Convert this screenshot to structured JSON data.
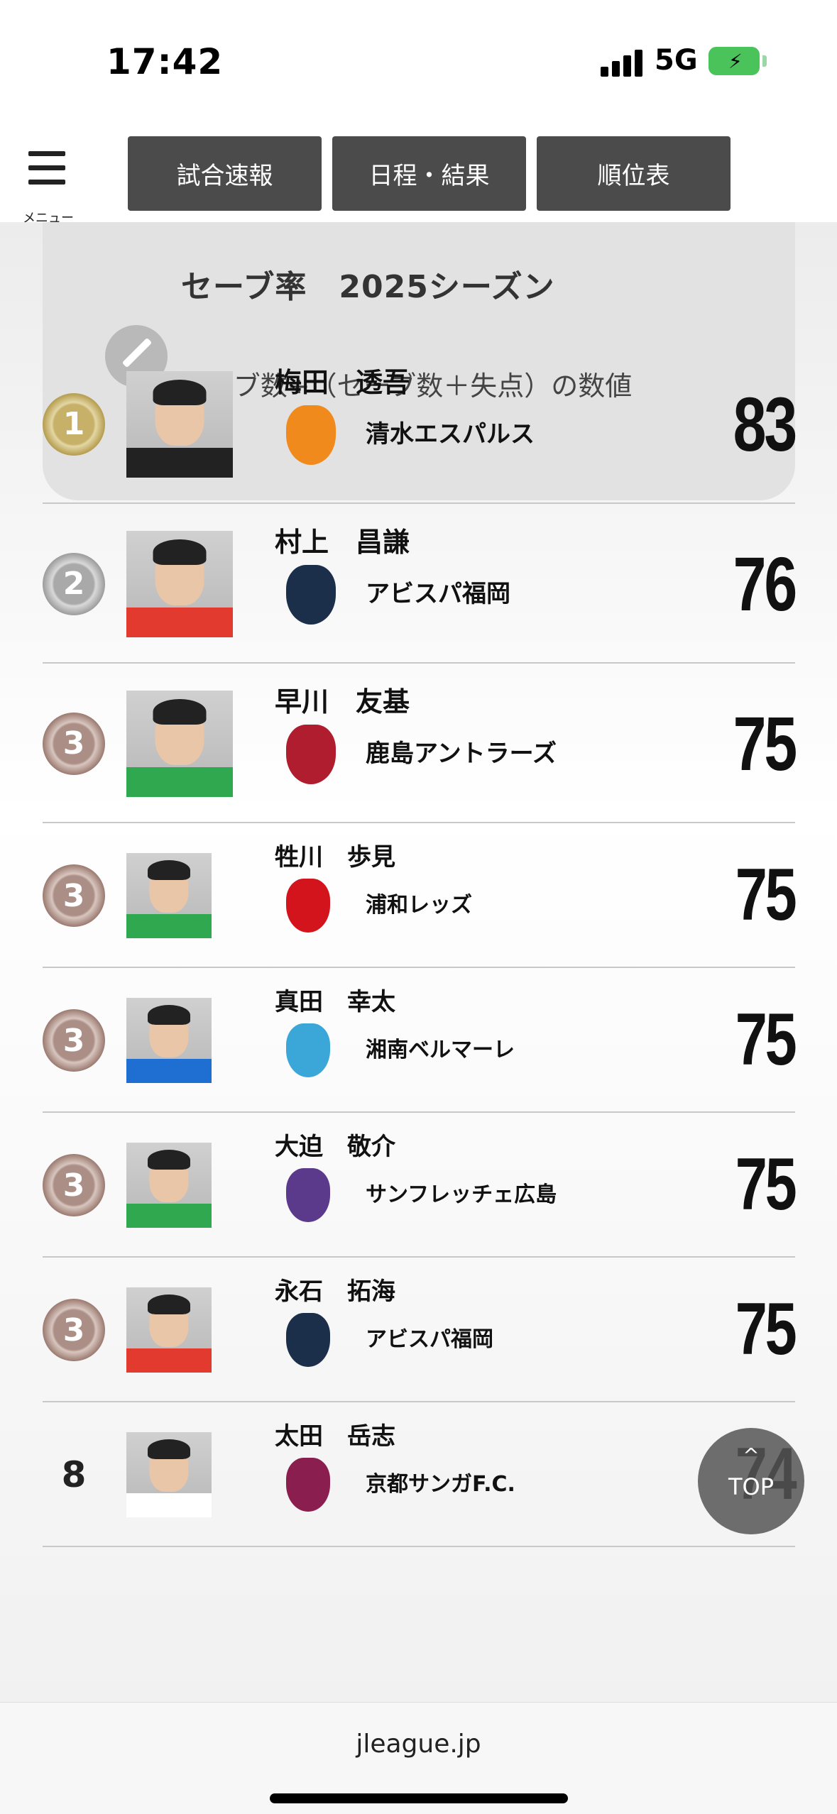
{
  "status_bar": {
    "time": "17:42",
    "network": "5G",
    "battery_color": "#4ac35a"
  },
  "header": {
    "menu_label": "メニュー",
    "nav": [
      "試合速報",
      "日程・結果",
      "順位表"
    ],
    "nav_bg": "#4b4b4b"
  },
  "card": {
    "title": "セーブ率　2025シーズン",
    "description": "セーブ数÷（セーブ数＋失点）の数値",
    "icon": "pencil-icon"
  },
  "rankings": [
    {
      "rank": "1",
      "medal": "gold",
      "name": "梅田　透吾",
      "club": "清水エスパルス",
      "club_color": "#f08a1c",
      "score": "83",
      "shirt": "#222222"
    },
    {
      "rank": "2",
      "medal": "silver",
      "name": "村上　昌謙",
      "club": "アビスパ福岡",
      "club_color": "#1b2f4a",
      "score": "76",
      "shirt": "#e23a2e"
    },
    {
      "rank": "3",
      "medal": "bronze",
      "name": "早川　友基",
      "club": "鹿島アントラーズ",
      "club_color": "#b01d2f",
      "score": "75",
      "shirt": "#2fa84f"
    },
    {
      "rank": "3",
      "medal": "bronze",
      "name": "牲川　歩見",
      "club": "浦和レッズ",
      "club_color": "#d4141d",
      "score": "75",
      "shirt": "#2fa84f"
    },
    {
      "rank": "3",
      "medal": "bronze",
      "name": "真田　幸太",
      "club": "湘南ベルマーレ",
      "club_color": "#3aa7d8",
      "score": "75",
      "shirt": "#1e6fd1"
    },
    {
      "rank": "3",
      "medal": "bronze",
      "name": "大迫　敬介",
      "club": "サンフレッチェ広島",
      "club_color": "#5b3a8c",
      "score": "75",
      "shirt": "#2fa84f"
    },
    {
      "rank": "3",
      "medal": "bronze",
      "name": "永石　拓海",
      "club": "アビスパ福岡",
      "club_color": "#1b2f4a",
      "score": "75",
      "shirt": "#e23a2e"
    },
    {
      "rank": "8",
      "medal": "plain",
      "name": "太田　岳志",
      "club": "京都サンガF.C.",
      "club_color": "#8a1f4f",
      "score": "74",
      "shirt": "#ffffff"
    }
  ],
  "top_button": {
    "caret": "^",
    "label": "TOP"
  },
  "footer": {
    "url": "jleague.jp"
  }
}
